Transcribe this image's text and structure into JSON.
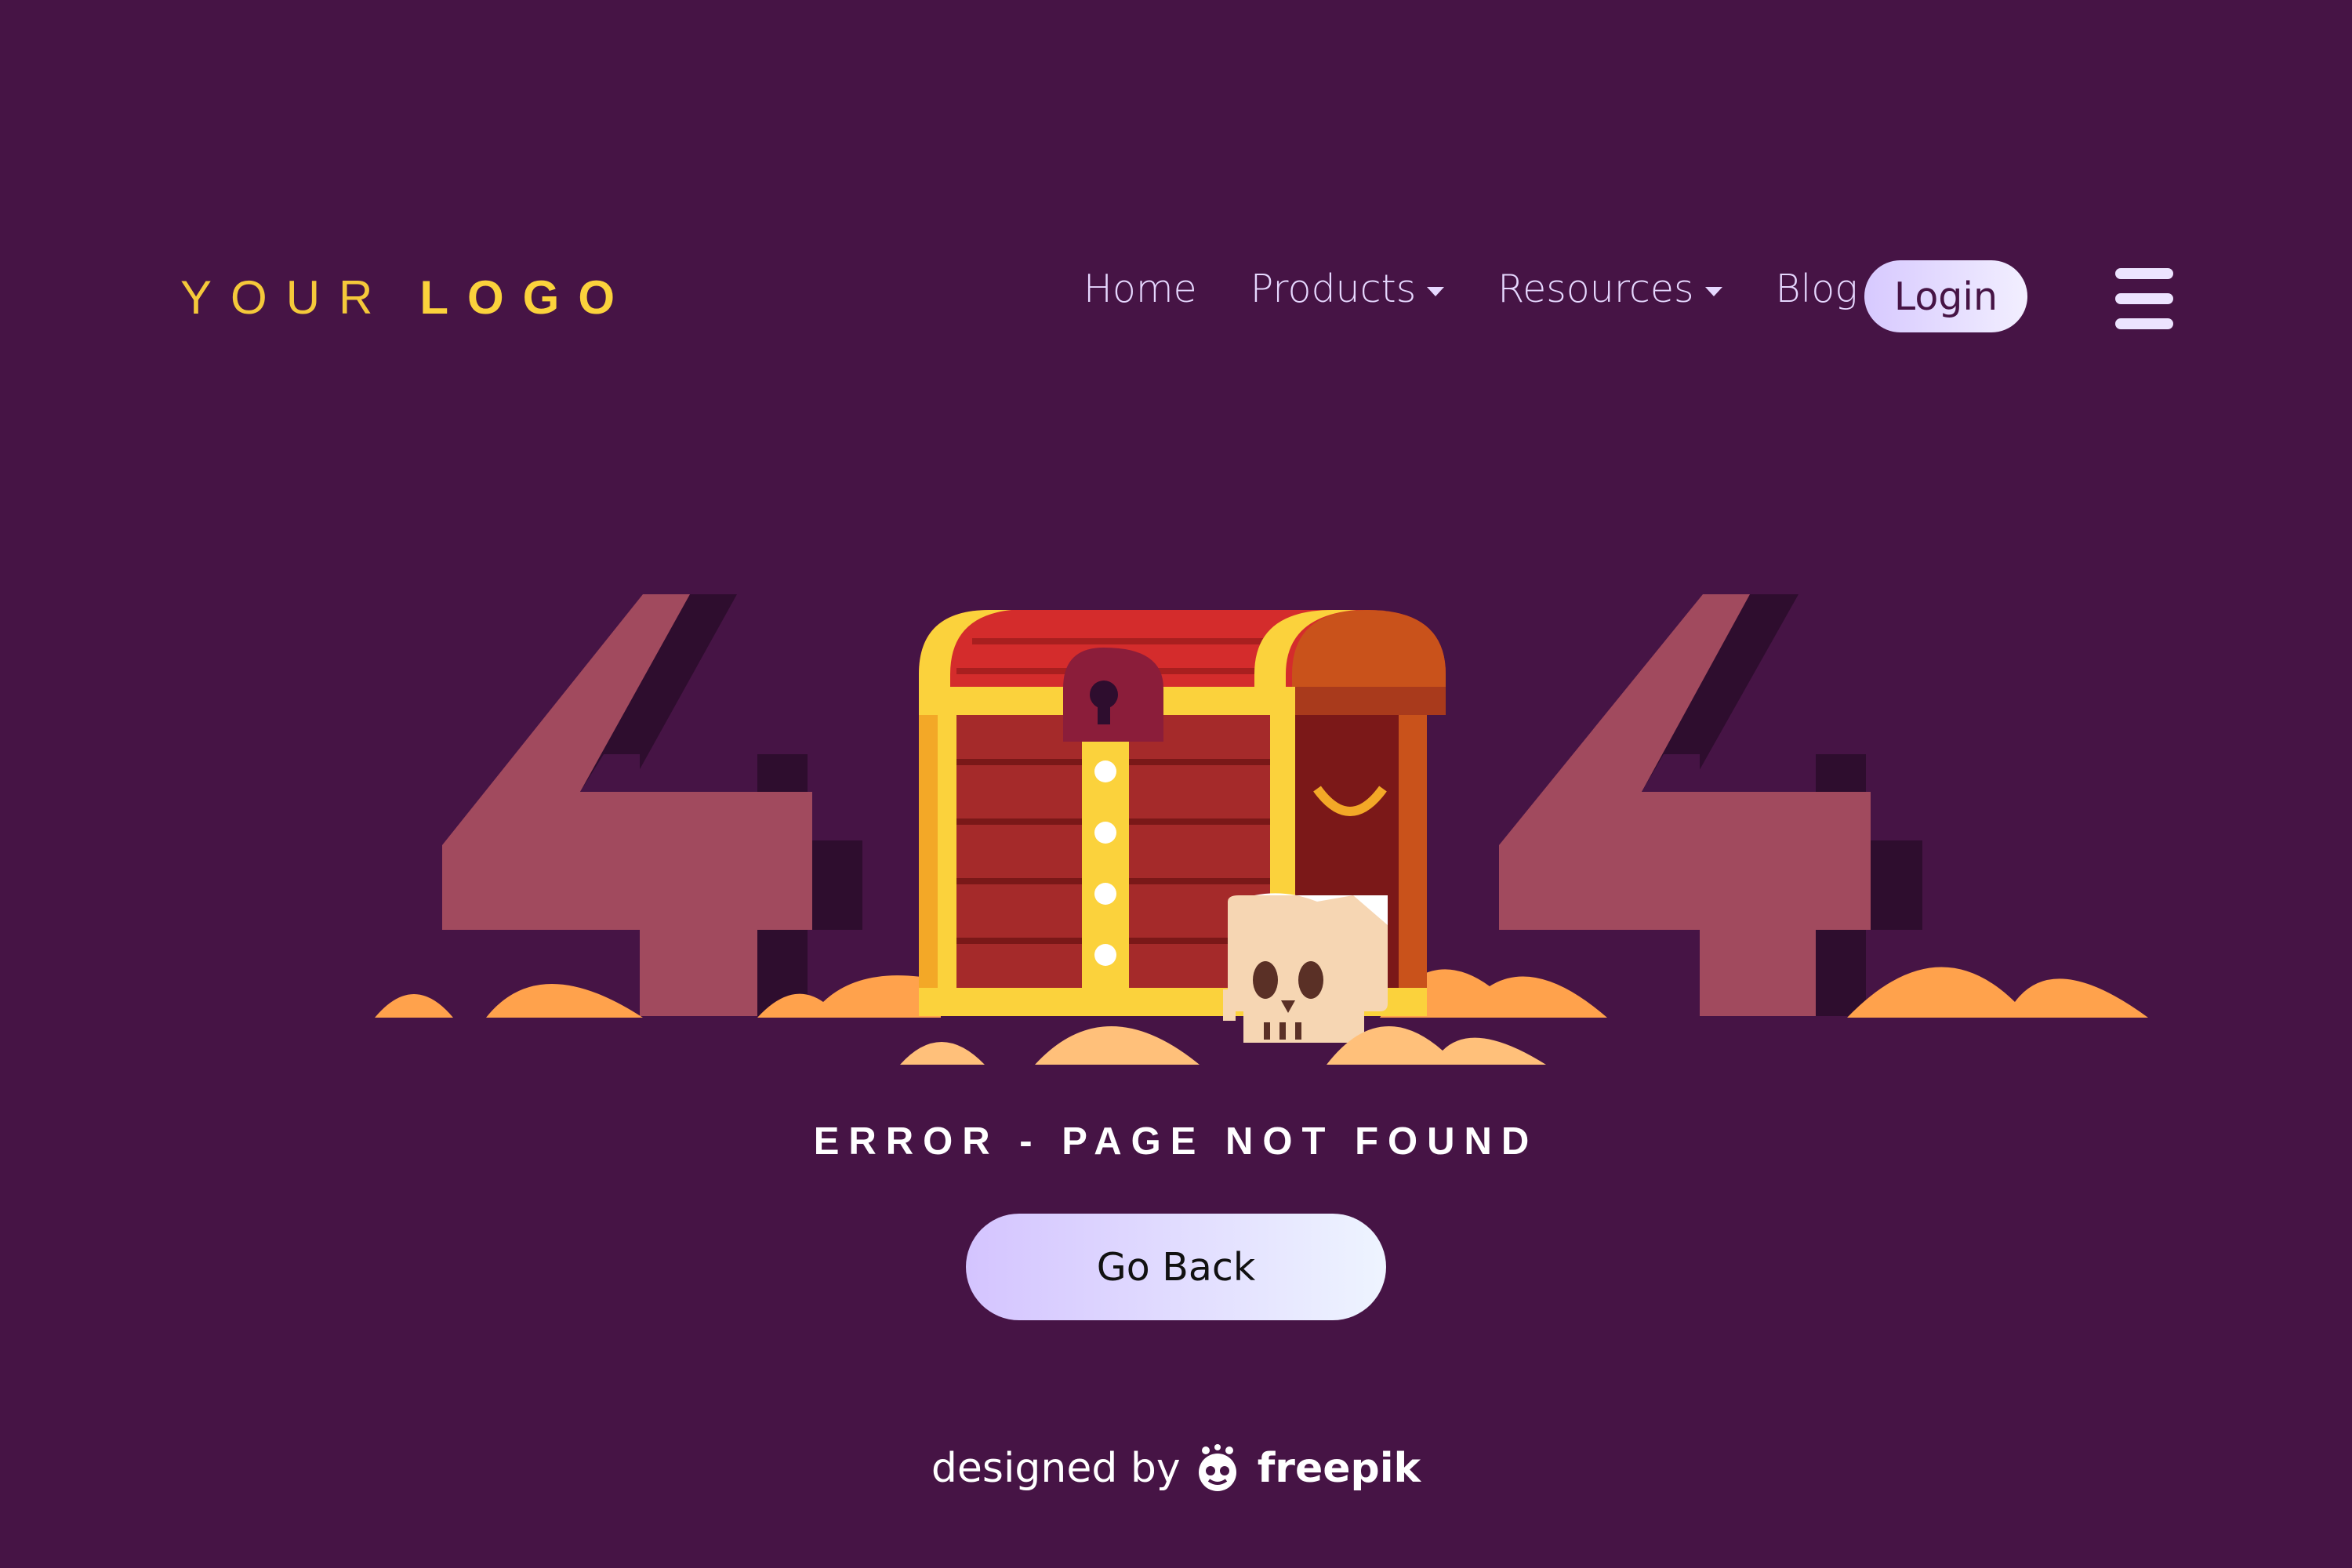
{
  "logo": {
    "part1": "YOUR",
    "part2": "LOGO"
  },
  "nav": {
    "items": [
      {
        "label": "Home",
        "dropdown": false
      },
      {
        "label": "Products",
        "dropdown": true
      },
      {
        "label": "Resources",
        "dropdown": true
      },
      {
        "label": "Blog",
        "dropdown": false
      }
    ],
    "login_label": "Login"
  },
  "hero": {
    "digit_left": "4",
    "digit_right": "4",
    "error_text": "ERROR - PAGE NOT FOUND",
    "go_back_label": "Go Back"
  },
  "footer": {
    "credit_prefix": "designed by",
    "credit_brand": "freepik"
  },
  "colors": {
    "background": "#461445",
    "logo_gold": "#fbd23c",
    "digit": "#a14a5e",
    "digit_shadow": "#2e0d2e",
    "chest_red": "#a52a2a",
    "chest_gold": "#fbd23c",
    "sand": "#ffa24c"
  }
}
